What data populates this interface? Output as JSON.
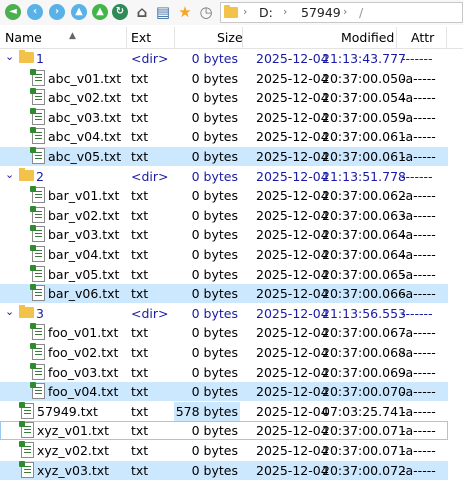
{
  "toolbar": {
    "buttons": [
      {
        "name": "back-icon",
        "glyph": "◄",
        "color": "#4caf50"
      },
      {
        "name": "back-round-icon",
        "glyph": "‹",
        "color": "#58b2e8"
      },
      {
        "name": "forward-round-icon",
        "glyph": "›",
        "color": "#58b2e8"
      },
      {
        "name": "up-icon",
        "glyph": "▲",
        "color": "#58b2e8"
      },
      {
        "name": "up-folder-icon",
        "glyph": "▲",
        "color": "#43b649"
      },
      {
        "name": "refresh-icon",
        "glyph": "↻",
        "color": "#2e8b57"
      },
      {
        "name": "home-icon",
        "glyph": "⌂",
        "color": "#555555"
      },
      {
        "name": "view-icon",
        "glyph": "▤",
        "color": "#3a6ea5"
      },
      {
        "name": "favorites-icon",
        "glyph": "★",
        "color": "#f5a623"
      },
      {
        "name": "history-icon",
        "glyph": "◷",
        "color": "#777777"
      }
    ],
    "path": {
      "drive": "D:",
      "folder": "57949",
      "sep": "›",
      "trailing": "/"
    }
  },
  "header": {
    "name": "Name",
    "ext": "Ext",
    "size": "Size",
    "modified": "Modified",
    "attr": "Attr"
  },
  "rows": [
    {
      "type": "dir",
      "name": "1",
      "ext": "<dir>",
      "size": "0 bytes",
      "date": "2025-12-04",
      "time": "21:13:43.777",
      "attr": "-------"
    },
    {
      "type": "file",
      "indent": 1,
      "name": "abc_v01.txt",
      "ext": "txt",
      "size": "0 bytes",
      "date": "2025-12-04",
      "time": "20:37:00.050",
      "attr": "-a-----"
    },
    {
      "type": "file",
      "indent": 1,
      "name": "abc_v02.txt",
      "ext": "txt",
      "size": "0 bytes",
      "date": "2025-12-04",
      "time": "20:37:00.054",
      "attr": "-a-----"
    },
    {
      "type": "file",
      "indent": 1,
      "name": "abc_v03.txt",
      "ext": "txt",
      "size": "0 bytes",
      "date": "2025-12-04",
      "time": "20:37:00.059",
      "attr": "-a-----"
    },
    {
      "type": "file",
      "indent": 1,
      "name": "abc_v04.txt",
      "ext": "txt",
      "size": "0 bytes",
      "date": "2025-12-04",
      "time": "20:37:00.061",
      "attr": "-a-----"
    },
    {
      "type": "file",
      "indent": 1,
      "name": "abc_v05.txt",
      "ext": "txt",
      "size": "0 bytes",
      "date": "2025-12-04",
      "time": "20:37:00.061",
      "attr": "-a-----",
      "selected": true
    },
    {
      "type": "dir",
      "name": "2",
      "ext": "<dir>",
      "size": "0 bytes",
      "date": "2025-12-04",
      "time": "21:13:51.778",
      "attr": "-------"
    },
    {
      "type": "file",
      "indent": 1,
      "name": "bar_v01.txt",
      "ext": "txt",
      "size": "0 bytes",
      "date": "2025-12-04",
      "time": "20:37:00.062",
      "attr": "-a-----"
    },
    {
      "type": "file",
      "indent": 1,
      "name": "bar_v02.txt",
      "ext": "txt",
      "size": "0 bytes",
      "date": "2025-12-04",
      "time": "20:37:00.063",
      "attr": "-a-----"
    },
    {
      "type": "file",
      "indent": 1,
      "name": "bar_v03.txt",
      "ext": "txt",
      "size": "0 bytes",
      "date": "2025-12-04",
      "time": "20:37:00.064",
      "attr": "-a-----"
    },
    {
      "type": "file",
      "indent": 1,
      "name": "bar_v04.txt",
      "ext": "txt",
      "size": "0 bytes",
      "date": "2025-12-04",
      "time": "20:37:00.064",
      "attr": "-a-----"
    },
    {
      "type": "file",
      "indent": 1,
      "name": "bar_v05.txt",
      "ext": "txt",
      "size": "0 bytes",
      "date": "2025-12-04",
      "time": "20:37:00.065",
      "attr": "-a-----"
    },
    {
      "type": "file",
      "indent": 1,
      "name": "bar_v06.txt",
      "ext": "txt",
      "size": "0 bytes",
      "date": "2025-12-04",
      "time": "20:37:00.066",
      "attr": "-a-----",
      "selected": true
    },
    {
      "type": "dir",
      "name": "3",
      "ext": "<dir>",
      "size": "0 bytes",
      "date": "2025-12-04",
      "time": "21:13:56.553",
      "attr": "-------"
    },
    {
      "type": "file",
      "indent": 1,
      "name": "foo_v01.txt",
      "ext": "txt",
      "size": "0 bytes",
      "date": "2025-12-04",
      "time": "20:37:00.067",
      "attr": "-a-----"
    },
    {
      "type": "file",
      "indent": 1,
      "name": "foo_v02.txt",
      "ext": "txt",
      "size": "0 bytes",
      "date": "2025-12-04",
      "time": "20:37:00.068",
      "attr": "-a-----"
    },
    {
      "type": "file",
      "indent": 1,
      "name": "foo_v03.txt",
      "ext": "txt",
      "size": "0 bytes",
      "date": "2025-12-04",
      "time": "20:37:00.069",
      "attr": "-a-----"
    },
    {
      "type": "file",
      "indent": 1,
      "name": "foo_v04.txt",
      "ext": "txt",
      "size": "0 bytes",
      "date": "2025-12-04",
      "time": "20:37:00.070",
      "attr": "-a-----",
      "selected": true
    },
    {
      "type": "file",
      "indent": 0,
      "name": "57949.txt",
      "ext": "txt",
      "size": "578 bytes",
      "date": "2025-12-04",
      "time": "07:03:25.741",
      "attr": "-a-----",
      "sizeHighlight": true
    },
    {
      "type": "file",
      "indent": 0,
      "name": "xyz_v01.txt",
      "ext": "txt",
      "size": "0 bytes",
      "date": "2025-12-04",
      "time": "20:37:00.071",
      "attr": "-a-----",
      "focus": true
    },
    {
      "type": "file",
      "indent": 0,
      "name": "xyz_v02.txt",
      "ext": "txt",
      "size": "0 bytes",
      "date": "2025-12-04",
      "time": "20:37:00.071",
      "attr": "-a-----"
    },
    {
      "type": "file",
      "indent": 0,
      "name": "xyz_v03.txt",
      "ext": "txt",
      "size": "0 bytes",
      "date": "2025-12-04",
      "time": "20:37:00.072",
      "attr": "-a-----",
      "selected": true
    }
  ]
}
